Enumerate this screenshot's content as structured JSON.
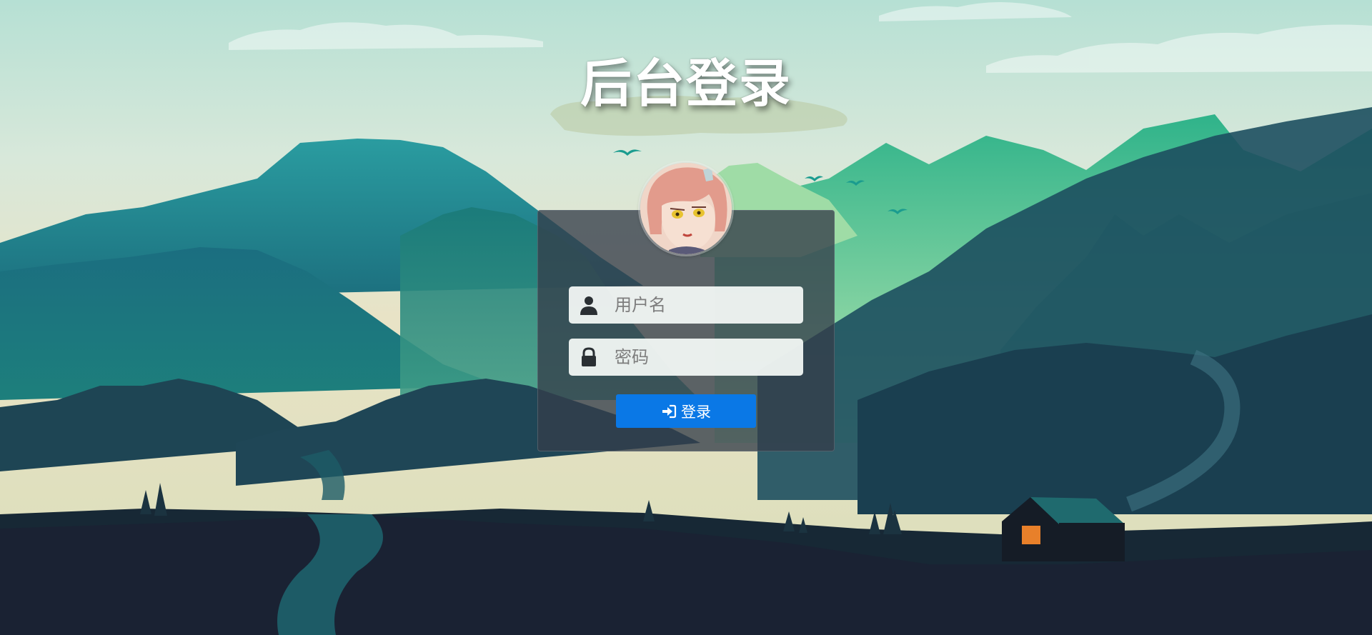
{
  "page": {
    "title": "后台登录"
  },
  "login": {
    "username": {
      "placeholder": "用户名",
      "value": "",
      "icon": "user-icon"
    },
    "password": {
      "placeholder": "密码",
      "value": "",
      "icon": "lock-icon"
    },
    "submit": {
      "label": "登录",
      "icon": "sign-in-icon"
    },
    "avatar": "avatar-image"
  },
  "colors": {
    "button": "#0a78e6",
    "panel": "rgba(52,62,74,0.78)",
    "sky_top": "#b6e0d4",
    "sky_bottom": "#e6e2c8",
    "ground": "#172030"
  }
}
